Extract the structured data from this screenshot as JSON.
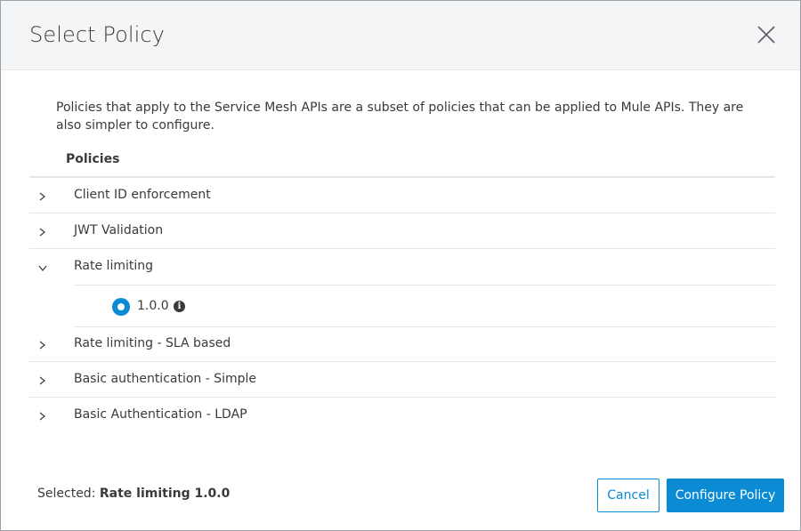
{
  "dialog": {
    "title": "Select Policy",
    "close_icon": "close-icon",
    "description": "Policies that apply to the Service Mesh APIs are a subset of policies that can be applied to Mule APIs. They are also simpler to configure.",
    "column_header": "Policies"
  },
  "policies": [
    {
      "label": "Client ID enforcement",
      "expanded": false
    },
    {
      "label": "JWT Validation",
      "expanded": false
    },
    {
      "label": "Rate limiting",
      "expanded": true
    },
    {
      "label": "Rate limiting - SLA based",
      "expanded": false
    },
    {
      "label": "Basic authentication - Simple",
      "expanded": false
    },
    {
      "label": "Basic Authentication - LDAP",
      "expanded": false
    }
  ],
  "rate_limiting_versions": [
    {
      "version": "1.0.0",
      "selected": true,
      "info_icon": "info-icon"
    }
  ],
  "footer": {
    "selected_prefix": "Selected:",
    "selected_value": "Rate limiting 1.0.0",
    "cancel_label": "Cancel",
    "configure_label": "Configure Policy"
  },
  "colors": {
    "accent": "#0a8bd4",
    "header_bg": "#f4f5f6",
    "text": "#3a3a3a"
  }
}
